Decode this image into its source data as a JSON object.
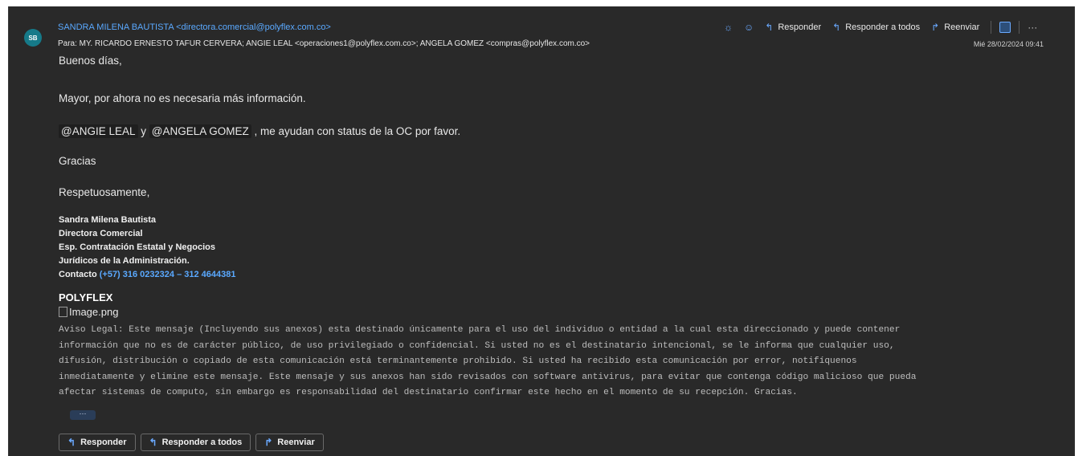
{
  "header": {
    "avatar_initials": "SB",
    "sender": "SANDRA MILENA BAUTISTA <directora.comercial@polyflex.com.co>",
    "to": "Para: MY. RICARDO ERNESTO TAFUR CERVERA;  ANGIE LEAL <operaciones1@polyflex.com.co>;  ANGELA GOMEZ <compras@polyflex.com.co>",
    "date": "Mié 28/02/2024 09:41"
  },
  "toolbar": {
    "reply_label": "Responder",
    "reply_all_label": "Responder a todos",
    "forward_label": "Reenviar",
    "more_label": "···"
  },
  "body": {
    "greeting": "Buenos días,",
    "line1": "Mayor, por ahora no es necesaria más información.",
    "mention1": "@ANGIE LEAL",
    "conj": " y ",
    "mention2": "@ANGELA GOMEZ",
    "line2_rest": " , me ayudan con status de la OC por favor.",
    "thanks": "Gracias",
    "closing": "Respetuosamente,"
  },
  "signature": {
    "name": "Sandra Milena Bautista",
    "title": "Directora Comercial",
    "esp1": "Esp. Contratación Estatal y Negocios",
    "esp2": "Jurídicos de la Administración.",
    "contact_label": "Contacto ",
    "contact_phone": "(+57) 316 0232324 – 312 4644381",
    "company": "POLYFLEX",
    "image_alt": "Image.png"
  },
  "legal": {
    "l1": "Aviso Legal: Este mensaje (Incluyendo sus anexos) esta destinado únicamente para el uso del individuo o entidad a la cual esta direccionado y puede contener",
    "l2": "información que no es de carácter público, de uso privilegiado o confidencial. Si usted no es el destinatario intencional, se le informa que cualquier uso,",
    "l3": "difusión, distribución o copiado de esta comunicación está terminantemente prohibido. Si usted ha recibido esta comunicación por error, notifíquenos",
    "l4": "inmediatamente y elimine este mensaje. Este mensaje y sus anexos han sido revisados con software antivirus, para evitar que contenga código malicioso que pueda",
    "l5": "afectar sistemas de computo, sin embargo es responsabilidad del destinatario confirmar este hecho en el momento de su recepción. Gracias."
  },
  "expand": {
    "label": "···"
  },
  "actions": {
    "reply": "Responder",
    "reply_all": "Responder a todos",
    "forward": "Reenviar"
  }
}
